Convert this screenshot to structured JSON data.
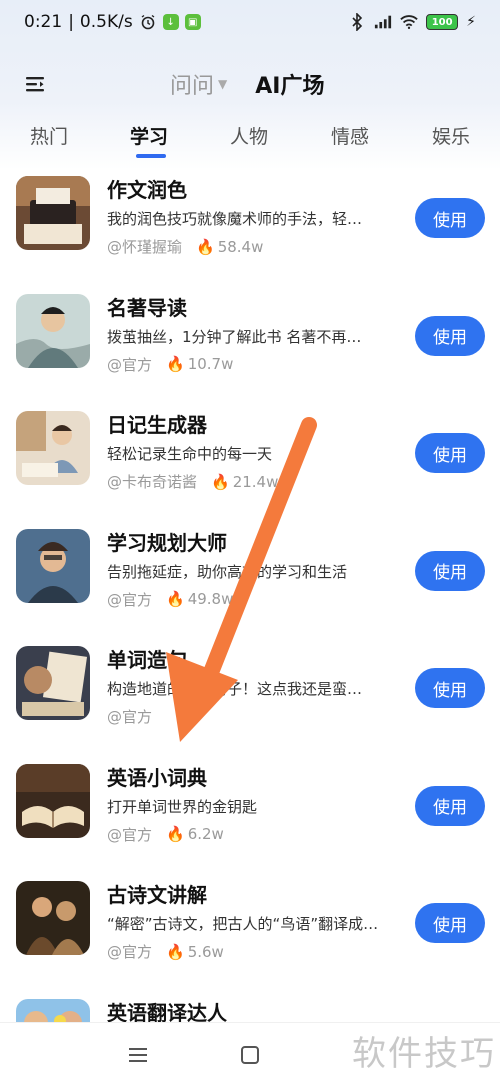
{
  "status": {
    "time": "0:21",
    "speed": "0.5K/s",
    "battery": "100"
  },
  "header": {
    "ask_label": "问问",
    "ai_square_label": "AI广场"
  },
  "tabs": [
    {
      "label": "热门"
    },
    {
      "label": "学习"
    },
    {
      "label": "人物"
    },
    {
      "label": "情感"
    },
    {
      "label": "娱乐"
    }
  ],
  "items": [
    {
      "title": "作文润色",
      "desc": "我的润色技巧就像魔术师的手法，轻…",
      "author": "@怀瑾握瑜",
      "count": "58.4w",
      "button": "使用"
    },
    {
      "title": "名著导读",
      "desc": "拨茧抽丝，1分钟了解此书 名著不再…",
      "author": "@官方",
      "count": "10.7w",
      "button": "使用"
    },
    {
      "title": "日记生成器",
      "desc": "轻松记录生命中的每一天",
      "author": "@卡布奇诺酱",
      "count": "21.4w",
      "button": "使用"
    },
    {
      "title": "学习规划大师",
      "desc": "告别拖延症，助你高效的学习和生活",
      "author": "@官方",
      "count": "49.8w",
      "button": "使用"
    },
    {
      "title": "单词造句",
      "desc": "构造地道的英语句子！这点我还是蛮…",
      "author": "@官方",
      "count": "w",
      "button": "使用"
    },
    {
      "title": "英语小词典",
      "desc": "打开单词世界的金钥匙",
      "author": "@官方",
      "count": "6.2w",
      "button": "使用"
    },
    {
      "title": "古诗文讲解",
      "desc": "“解密”古诗文，把古人的“鸟语”翻译成…",
      "author": "@官方",
      "count": "5.6w",
      "button": "使用"
    },
    {
      "title": "英语翻译达人",
      "desc": "",
      "author": "",
      "count": "",
      "button": ""
    }
  ],
  "watermark": "软件技巧",
  "colors": {
    "accent": "#2f73f0",
    "arrow": "#f47a3c"
  }
}
